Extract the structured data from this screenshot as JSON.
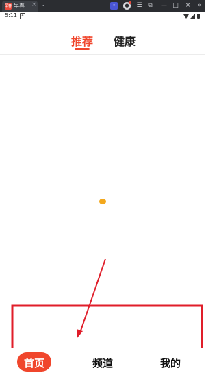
{
  "window": {
    "tab_title": "早春",
    "app_icon_text": "早春",
    "tab_close": "×",
    "tab_dropdown": "⌄",
    "controls": [
      "☰",
      "⧉",
      "—",
      "□",
      "×",
      "»"
    ]
  },
  "status_bar": {
    "time": "5:11",
    "notification_icon": "A"
  },
  "top_tabs": {
    "recommend": "推荐",
    "health": "健康"
  },
  "bottom_nav": {
    "home": "首页",
    "channel": "频道",
    "mine": "我的"
  },
  "colors": {
    "accent": "#f0462c",
    "annotation": "#e01e2a",
    "loading_dot": "#f3a81d"
  }
}
